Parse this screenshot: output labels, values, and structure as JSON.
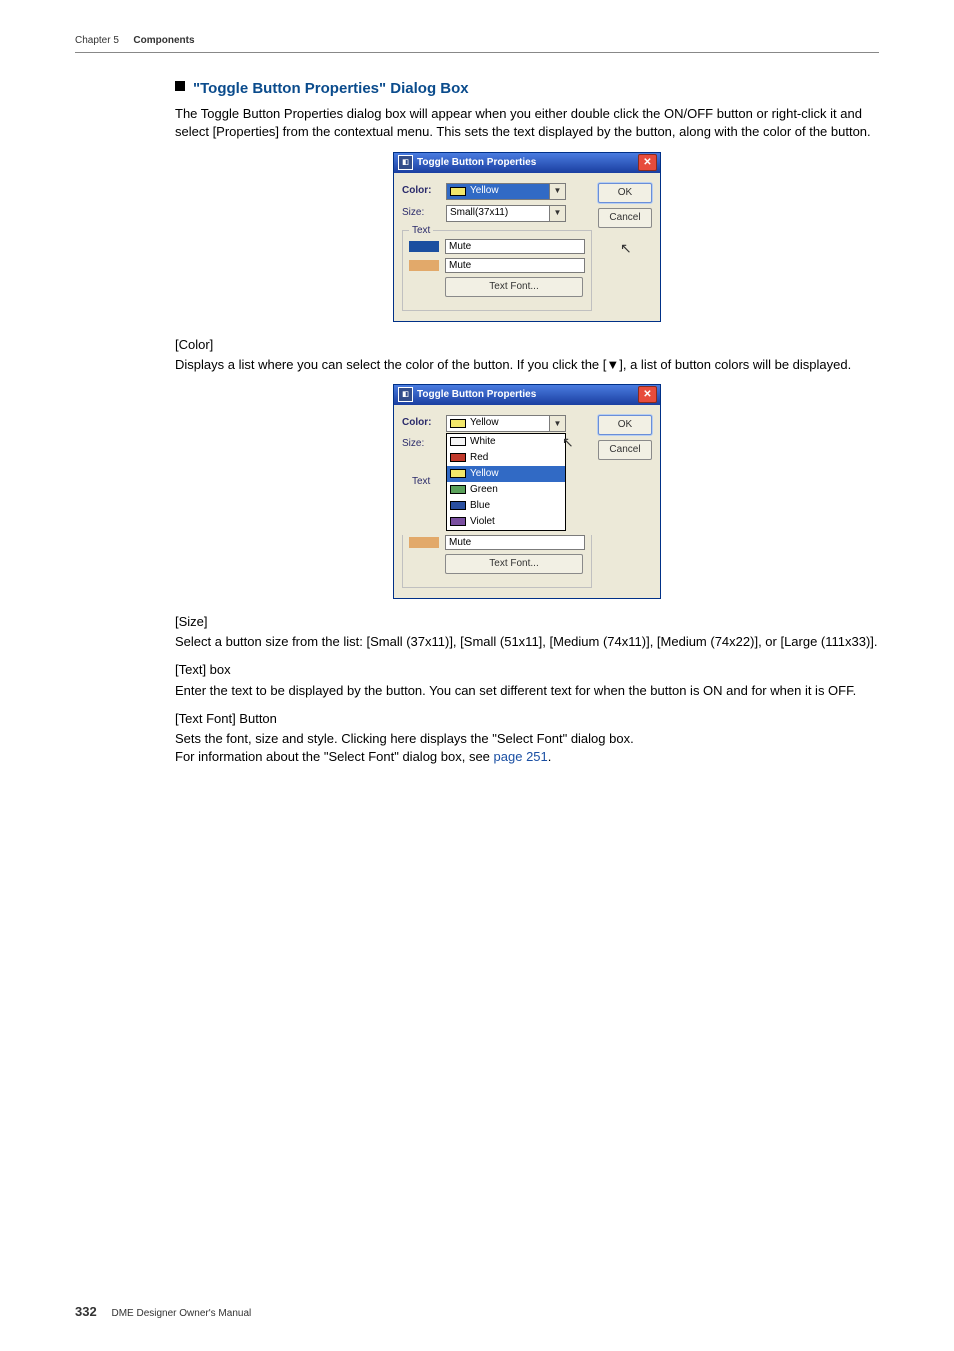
{
  "header": {
    "chapter": "Chapter 5",
    "section": "Components"
  },
  "title": {
    "text": "\"Toggle Button Properties\" Dialog Box"
  },
  "intro": "The Toggle Button Properties dialog box will appear when you either double click the ON/OFF button or right-click it and select [Properties] from the contextual menu. This sets the text displayed by the button, along with the color of the button.",
  "dialog1": {
    "title": "Toggle Button Properties",
    "color_label": "Color:",
    "color_value": "Yellow",
    "size_label": "Size:",
    "size_value": "Small(37x11)",
    "text_group": "Text",
    "text_on": "Mute",
    "text_off": "Mute",
    "textfont_btn": "Text Font...",
    "ok": "OK",
    "cancel": "Cancel"
  },
  "color_section": {
    "heading": "[Color]",
    "text": "Displays a list where you can select the color of the button. If you click the [▼], a list of button colors will be displayed."
  },
  "dialog2": {
    "title": "Toggle Button Properties",
    "color_label": "Color:",
    "size_label": "Size:",
    "text_group": "Text",
    "selected": "Yellow",
    "options": {
      "white": "White",
      "red": "Red",
      "yellow": "Yellow",
      "green": "Green",
      "blue": "Blue",
      "violet": "Violet"
    },
    "text_off": "Mute",
    "textfont_btn": "Text Font...",
    "ok": "OK",
    "cancel": "Cancel"
  },
  "size_section": {
    "heading": "[Size]",
    "text": "Select a button size from the list: [Small (37x11)], [Small (51x11], [Medium (74x11)], [Medium (74x22)], or [Large (111x33)]."
  },
  "textbox_section": {
    "heading": "[Text] box",
    "text": "Enter the text to be displayed by the button. You can set different text for when the button is ON and for when it is OFF."
  },
  "textfont_section": {
    "heading": "[Text Font] Button",
    "line1": "Sets the font, size and style. Clicking here displays the \"Select Font\" dialog box.",
    "line2_prefix": "For information about the \"Select Font\" dialog box, see ",
    "line2_link": "page 251",
    "line2_suffix": "."
  },
  "footer": {
    "page": "332",
    "doc": "DME Designer Owner's Manual"
  },
  "colors": {
    "yellow": "#f2e76a",
    "white": "#f5f5f5",
    "red": "#c0392b",
    "green": "#5aa15a",
    "blue": "#2a4fa0",
    "violet": "#7a4fa0",
    "orange": "#e2a96a"
  }
}
